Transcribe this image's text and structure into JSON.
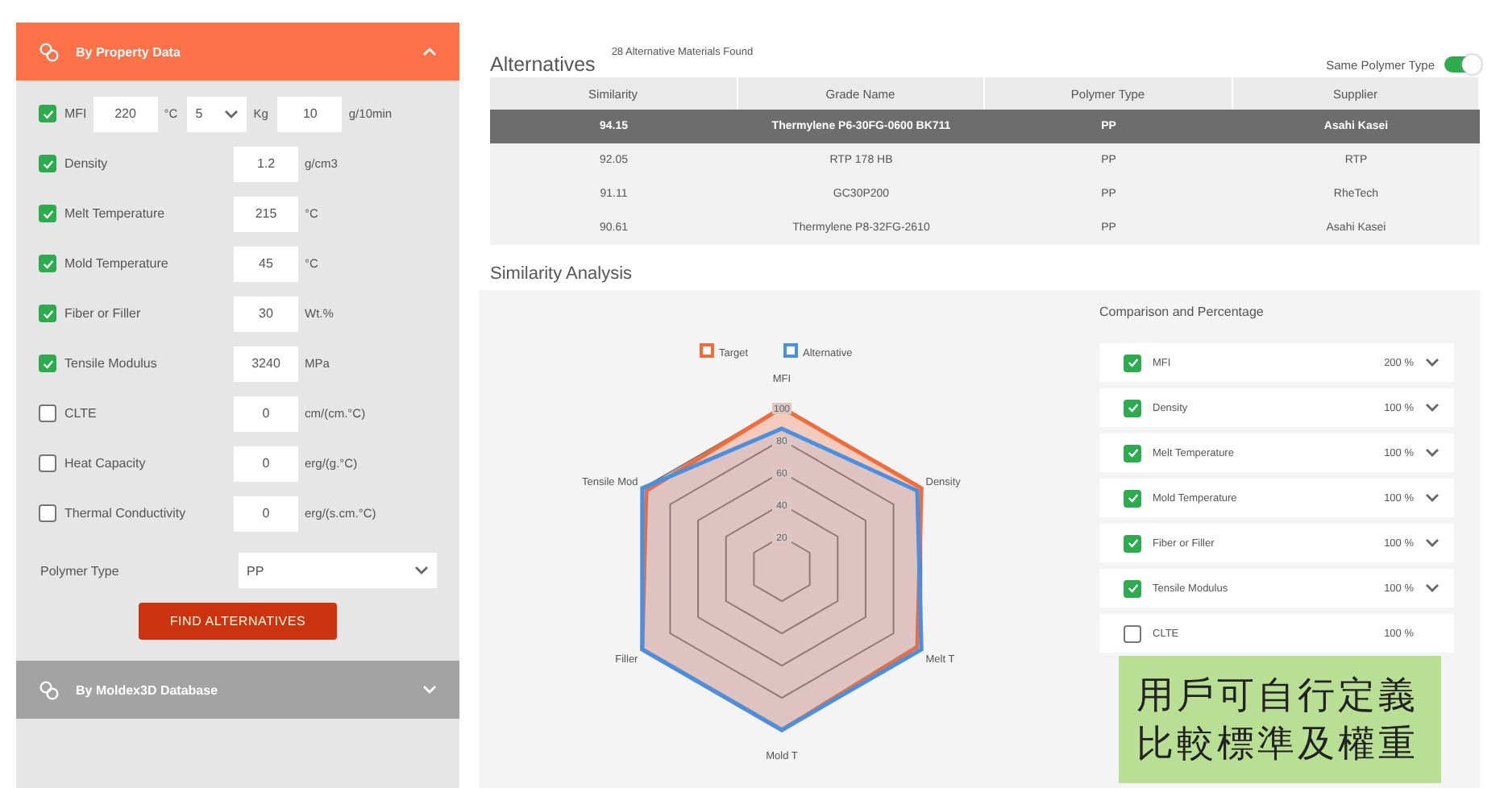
{
  "filter_panel": {
    "header": {
      "title": "By Property Data",
      "expanded": true
    },
    "properties": [
      {
        "kind": "mfi",
        "label": "MFI",
        "checked": true,
        "temperature": "220",
        "temperature_unit": "°C",
        "load": "5",
        "load_unit": "Kg",
        "value": "10",
        "unit": "g/10min"
      },
      {
        "kind": "single",
        "label": "Density",
        "checked": true,
        "value": "1.2",
        "unit": "g/cm3"
      },
      {
        "kind": "single",
        "label": "Melt Temperature",
        "checked": true,
        "value": "215",
        "unit": "°C"
      },
      {
        "kind": "single",
        "label": "Mold Temperature",
        "checked": true,
        "value": "45",
        "unit": "°C"
      },
      {
        "kind": "single",
        "label": "Fiber or Filler",
        "checked": true,
        "value": "30",
        "unit": "Wt.%"
      },
      {
        "kind": "single",
        "label": "Tensile Modulus",
        "checked": true,
        "value": "3240",
        "unit": "MPa"
      },
      {
        "kind": "single",
        "label": "CLTE",
        "checked": false,
        "value": "0",
        "unit": "cm/(cm.°C)"
      },
      {
        "kind": "single",
        "label": "Heat Capacity",
        "checked": false,
        "value": "0",
        "unit": "erg/(g.°C)"
      },
      {
        "kind": "single",
        "label": "Thermal Conductivity",
        "checked": false,
        "value": "0",
        "unit": "erg/(s.cm.°C)"
      }
    ],
    "polymer_type": {
      "label": "Polymer Type",
      "value": "PP"
    },
    "find_button": "FIND ALTERNATIVES",
    "database_header": {
      "title": "By Moldex3D Database",
      "expanded": false
    }
  },
  "alternatives": {
    "title": "Alternatives",
    "count_text": "28 Alternative Materials Found",
    "same_polymer_type": {
      "label": "Same Polymer Type",
      "on": true
    },
    "columns": [
      "Similarity",
      "Grade Name",
      "Polymer Type",
      "Supplier"
    ],
    "rows": [
      {
        "cells": [
          "94.15",
          "Thermylene P6-30FG-0600 BK711",
          "PP",
          "Asahi Kasei"
        ],
        "selected": true
      },
      {
        "cells": [
          "92.05",
          "RTP 178 HB",
          "PP",
          "RTP"
        ],
        "selected": false
      },
      {
        "cells": [
          "91.11",
          "GC30P200",
          "PP",
          "RheTech"
        ],
        "selected": false
      },
      {
        "cells": [
          "90.61",
          "Thermylene P8-32FG-2610",
          "PP",
          "Asahi Kasei"
        ],
        "selected": false
      }
    ]
  },
  "similarity": {
    "title": "Similarity Analysis",
    "chart_data": {
      "type": "radar",
      "categories": [
        "MFI",
        "Density",
        "Melt T",
        "Mold T",
        "Filler",
        "Tensile Mod"
      ],
      "series": [
        {
          "name": "Target",
          "color": "#f26b3a",
          "values": [
            100,
            100,
            97,
            100,
            100,
            97
          ]
        },
        {
          "name": "Alternative",
          "color": "#4a90e2",
          "values": [
            87,
            97,
            100,
            100,
            100,
            100
          ]
        }
      ],
      "ylim": [
        0,
        100
      ],
      "yticks": [
        20,
        40,
        60,
        80,
        100
      ],
      "legend": "top"
    },
    "comparison": {
      "title": "Comparison and Percentage",
      "items": [
        {
          "label": "MFI",
          "checked": true,
          "percent": "200 %"
        },
        {
          "label": "Density",
          "checked": true,
          "percent": "100 %"
        },
        {
          "label": "Melt Temperature",
          "checked": true,
          "percent": "100 %"
        },
        {
          "label": "Mold Temperature",
          "checked": true,
          "percent": "100 %"
        },
        {
          "label": "Fiber or Filler",
          "checked": true,
          "percent": "100 %"
        },
        {
          "label": "Tensile Modulus",
          "checked": true,
          "percent": "100 %"
        },
        {
          "label": "CLTE",
          "checked": false,
          "percent": "100 %"
        }
      ]
    }
  },
  "note": {
    "lines": [
      "用戶可自行定義",
      "比較標準及權重"
    ]
  }
}
